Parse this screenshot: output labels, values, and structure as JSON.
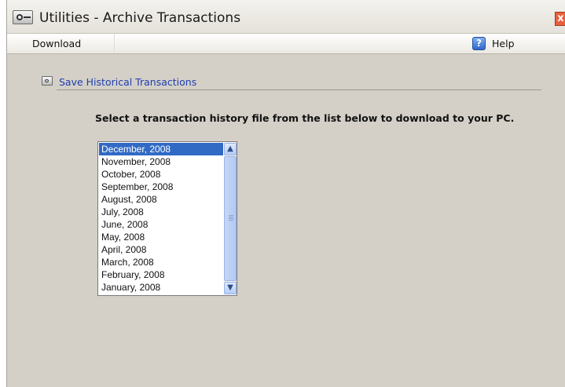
{
  "window": {
    "title": "Utilities - Archive Transactions",
    "app_icon": "safe-icon",
    "close_icon": "close-icon",
    "close_glyph": "x"
  },
  "menu": {
    "download_label": "Download",
    "help_label": "Help",
    "help_glyph": "?",
    "help_icon": "help-icon"
  },
  "section": {
    "icon": "safe-icon",
    "link_label": "Save Historical Transactions"
  },
  "instruction": "Select a transaction history file from the list below to download to your PC.",
  "list": {
    "selected_index": 0,
    "items": [
      "December, 2008",
      "November, 2008",
      "October, 2008",
      "September, 2008",
      "August, 2008",
      "July, 2008",
      "June, 2008",
      "May, 2008",
      "April, 2008",
      "March, 2008",
      "February, 2008",
      "January, 2008"
    ],
    "scroll_up_glyph": "▲",
    "scroll_down_glyph": "▼"
  },
  "colors": {
    "window_bg": "#d4d0c8",
    "selection": "#316ac5",
    "link": "#1f3fb0",
    "close": "#e8603c"
  }
}
